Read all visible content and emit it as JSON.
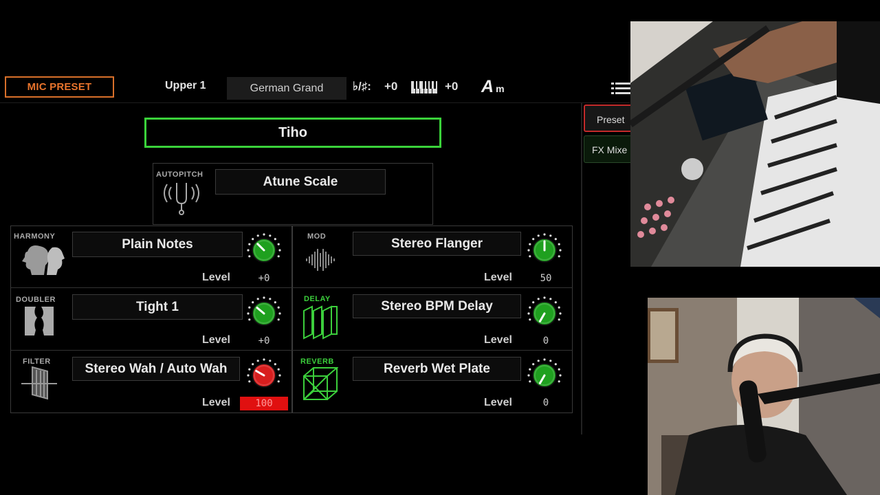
{
  "header": {
    "mic_preset": "MIC PRESET",
    "upper": "Upper 1",
    "sound": "German Grand",
    "transpose_label": "♭/♯:",
    "transpose_value": "+0",
    "octave_value": "+0",
    "chord_root": "A",
    "chord_type": "m"
  },
  "side_buttons": {
    "preset": "Preset",
    "fx_mixer": "FX Mixe"
  },
  "preset_name": "Tiho",
  "autopitch": {
    "label": "AUTOPITCH",
    "value": "Atune Scale"
  },
  "fx": {
    "harmony": {
      "label": "HARMONY",
      "name": "Plain Notes",
      "level_label": "Level",
      "level": "+0",
      "knob": "green"
    },
    "mod": {
      "label": "MOD",
      "name": "Stereo Flanger",
      "level_label": "Level",
      "level": "50",
      "knob": "green"
    },
    "doubler": {
      "label": "DOUBLER",
      "name": "Tight 1",
      "level_label": "Level",
      "level": "+0",
      "knob": "green"
    },
    "delay": {
      "label": "DELAY",
      "name": "Stereo BPM Delay",
      "level_label": "Level",
      "level": "0",
      "knob": "green"
    },
    "filter": {
      "label": "FILTER",
      "name": "Stereo Wah / Auto Wah",
      "level_label": "Level",
      "level": "100",
      "knob": "red"
    },
    "reverb": {
      "label": "REVERB",
      "name": "Reverb Wet Plate",
      "level_label": "Level",
      "level": "0",
      "knob": "green"
    }
  },
  "colors": {
    "accent_orange": "#e8742c",
    "active_green": "#3ad23a",
    "knob_green": "#1fa01f",
    "knob_red": "#d81e1e",
    "highlight_red": "#e01010"
  }
}
